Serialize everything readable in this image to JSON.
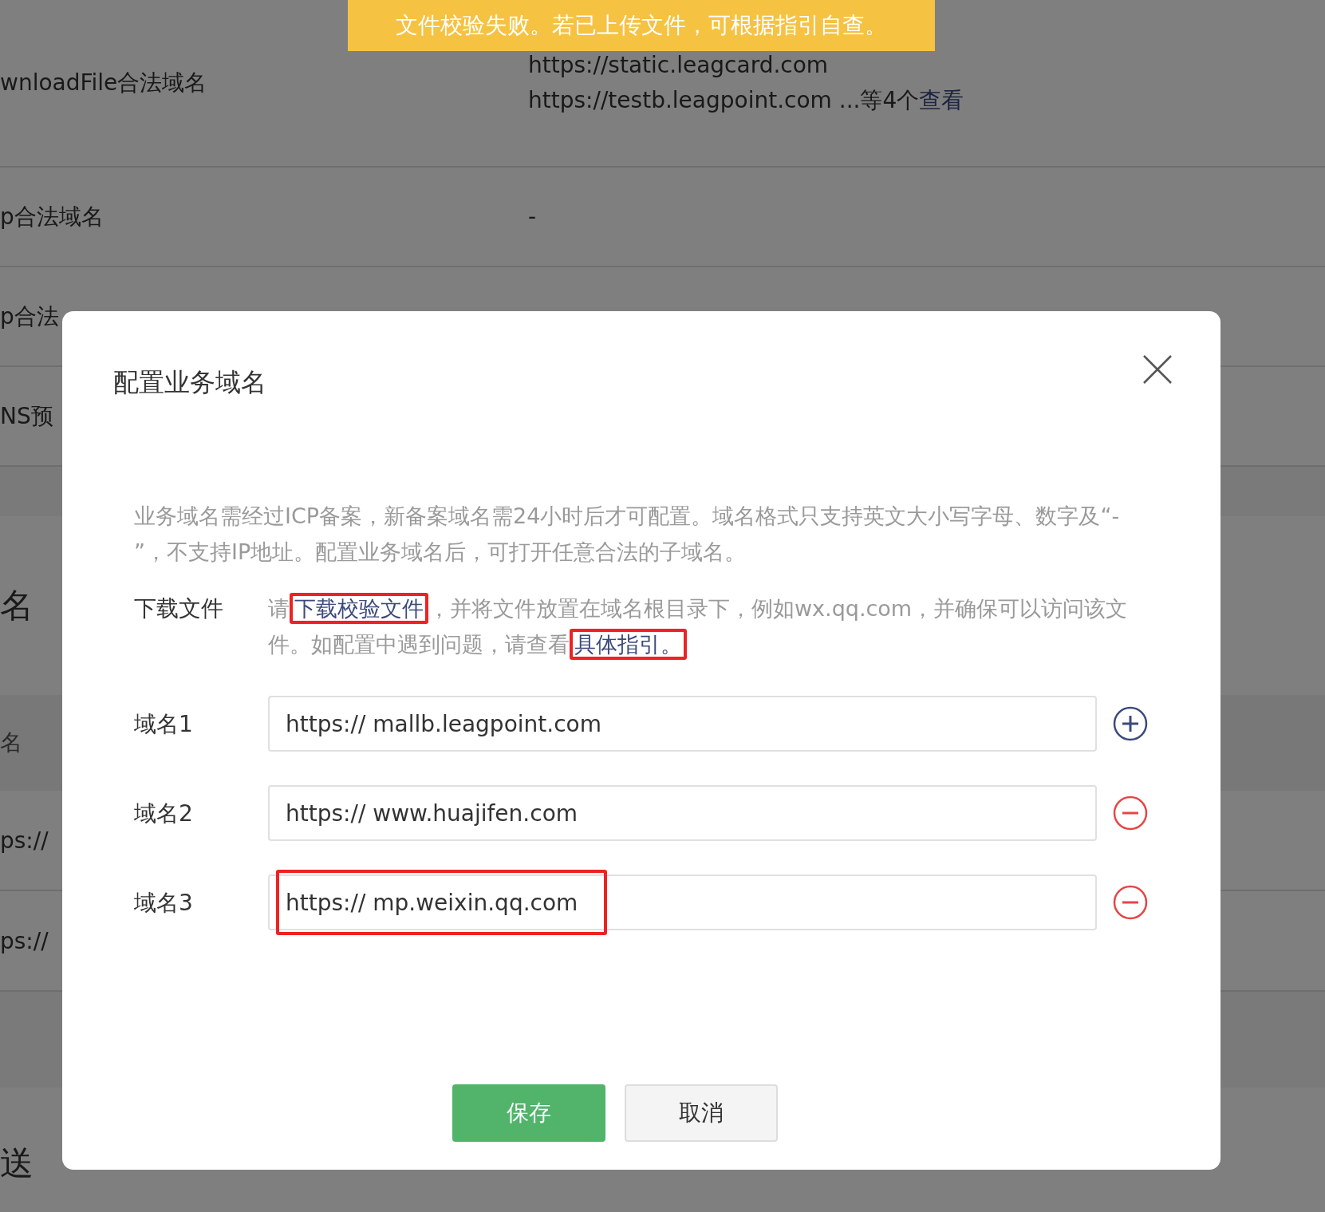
{
  "toast": {
    "text": "文件校验失败。若已上传文件，可根据指引自查。"
  },
  "background": {
    "rows": [
      {
        "label": "wnloadFile合法域名",
        "lines": [
          "https://static.leagcard.com"
        ],
        "more": "https://testb.leagpoint.com ...等4个",
        "link": "查看"
      },
      {
        "label": "p合法域名",
        "value": "-"
      },
      {
        "label": "p合法"
      },
      {
        "label": "NS预"
      }
    ],
    "section_title": "名",
    "table_header": "名",
    "table_rows": [
      "ps://",
      "ps://"
    ],
    "section_title_2": "送"
  },
  "modal": {
    "title": "配置业务域名",
    "notice": "业务域名需经过ICP备案，新备案域名需24小时后才可配置。域名格式只支持英文大小写字母、数字及“- ”，不支持IP地址。配置业务域名后，可打开任意合法的子域名。",
    "download": {
      "label": "下载文件",
      "parts": [
        {
          "kind": "text",
          "text": "请"
        },
        {
          "kind": "link",
          "text": "下载校验文件",
          "highlighted": true
        },
        {
          "kind": "text",
          "text": "，并将文件放置在域名根目录下，例如wx.qq.com，并确保可以访问该文件。如配置中遇到问题，请查看"
        },
        {
          "kind": "link",
          "text": "具体指引。",
          "highlighted": true
        }
      ]
    },
    "domains": [
      {
        "label": "域名1",
        "value": "https:// mallb.leagpoint.com",
        "kind": "add",
        "highlighted": false
      },
      {
        "label": "域名2",
        "value": "https:// www.huajifen.com",
        "kind": "remove",
        "highlighted": false
      },
      {
        "label": "域名3",
        "value": "https:// mp.weixin.qq.com",
        "kind": "remove",
        "highlighted": true
      }
    ],
    "buttons": [
      {
        "label": "保存",
        "kind": "primary"
      },
      {
        "label": "取消",
        "kind": "default"
      }
    ]
  }
}
